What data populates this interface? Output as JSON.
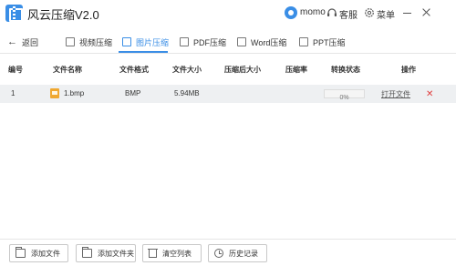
{
  "app": {
    "title": "风云压缩V2.0"
  },
  "titlebar": {
    "user_name": "momo",
    "service_label": "客服",
    "menu_label": "菜单"
  },
  "nav": {
    "back_label": "返回",
    "tabs": [
      {
        "label": "视频压缩",
        "icon": "video-icon",
        "active": false
      },
      {
        "label": "图片压缩",
        "icon": "image-icon",
        "active": true
      },
      {
        "label": "PDF压缩",
        "icon": "pdf-icon",
        "active": false
      },
      {
        "label": "Word压缩",
        "icon": "word-icon",
        "active": false
      },
      {
        "label": "PPT压缩",
        "icon": "ppt-icon",
        "active": false
      }
    ]
  },
  "table": {
    "headers": [
      "编号",
      "文件名称",
      "文件格式",
      "文件大小",
      "压缩后大小",
      "压缩率",
      "转换状态",
      "操作"
    ],
    "rows": [
      {
        "index": "1",
        "name": "1.bmp",
        "format": "BMP",
        "size": "5.94MB",
        "compressed_size": "",
        "ratio": "",
        "progress": 0,
        "progress_text": "0%",
        "action_open": "打开文件"
      }
    ]
  },
  "bottom": {
    "add_file": "添加文件",
    "add_folder": "添加文件夹",
    "clear_list": "清空列表",
    "history": "历史记录"
  },
  "colors": {
    "accent": "#3a8ee6",
    "delete": "#e04040",
    "row_bg": "#eef0f2"
  }
}
